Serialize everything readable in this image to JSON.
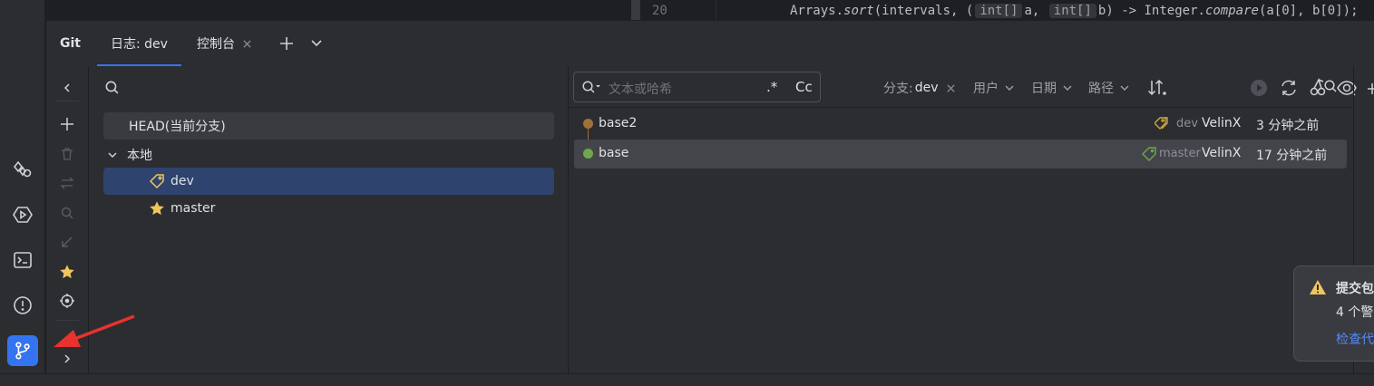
{
  "editor": {
    "line_number": "20",
    "code_start": "Arrays.",
    "code_method": "sort",
    "code_mid": "(intervals, (",
    "hint1": "int[]",
    "param1": "a,",
    "hint2": "int[]",
    "param2": "b) -> Integer.",
    "code_method2": "compare",
    "code_end": "(a[0], b[0]);"
  },
  "tool_window": {
    "title": "Git",
    "tabs": [
      {
        "label": "日志: dev"
      },
      {
        "label": "控制台"
      }
    ]
  },
  "branches": {
    "head_label": "HEAD(当前分支)",
    "local_group": "本地",
    "items": [
      {
        "label": "dev"
      },
      {
        "label": "master"
      }
    ]
  },
  "filters": {
    "search_placeholder": "文本或哈希",
    "regex_label": ".*",
    "case_label": "Cc",
    "branch_label": "分支:",
    "branch_value": "dev",
    "user_label": "用户",
    "date_label": "日期",
    "path_label": "路径"
  },
  "commits": [
    {
      "message": "base2",
      "tag": "dev",
      "author": "VelinX",
      "time": "3 分钟之前",
      "dot_color": "#a0703a"
    },
    {
      "message": "base",
      "tag": "master",
      "author": "VelinX",
      "time": "17 分钟之前",
      "dot_color": "#6fa84a"
    }
  ],
  "notification": {
    "title": "提交包",
    "body": "4 个警",
    "link": "检查代"
  },
  "colors": {
    "accent": "#3574f0",
    "tag_dev": "#c9a93c",
    "tag_master": "#6fa84a",
    "warning": "#f2c55c"
  }
}
